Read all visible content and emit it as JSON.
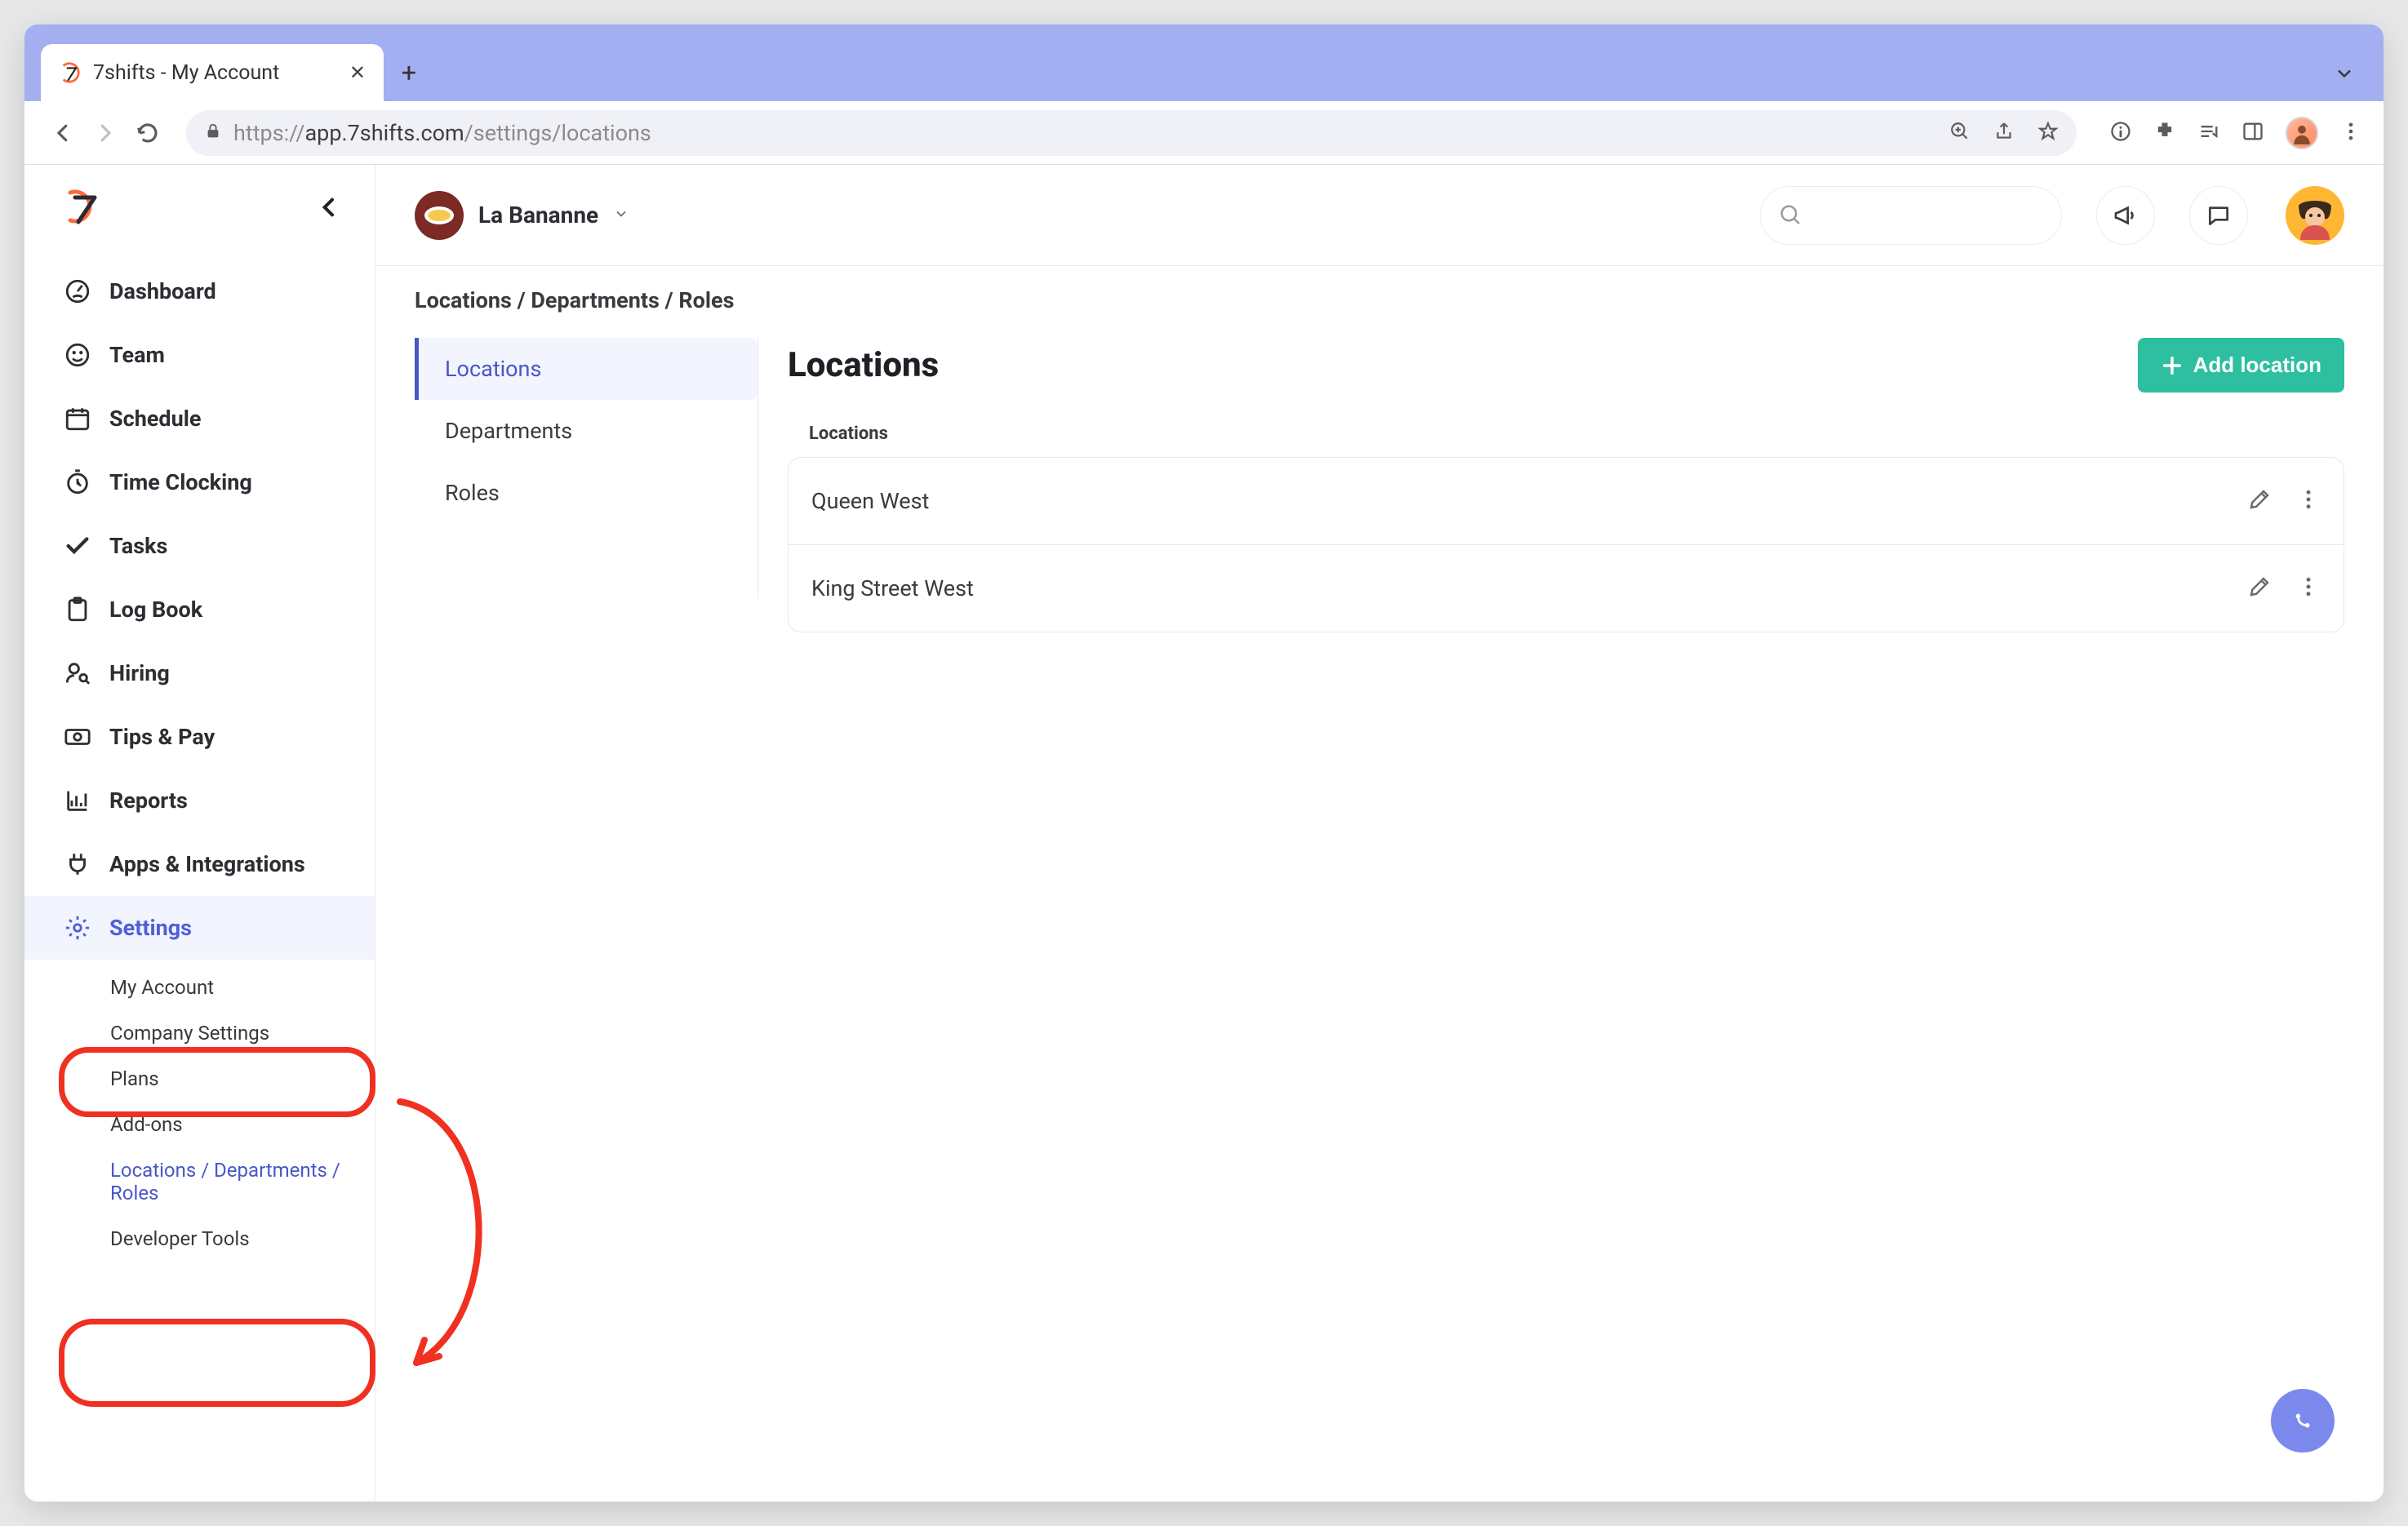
{
  "browser": {
    "tab_title": "7shifts - My Account",
    "url_host_prefix": "https://",
    "url_host_bold": "app.7shifts.com",
    "url_path": "/settings/locations"
  },
  "sidebar": {
    "items": [
      {
        "label": "Dashboard"
      },
      {
        "label": "Team"
      },
      {
        "label": "Schedule"
      },
      {
        "label": "Time Clocking"
      },
      {
        "label": "Tasks"
      },
      {
        "label": "Log Book"
      },
      {
        "label": "Hiring"
      },
      {
        "label": "Tips & Pay"
      },
      {
        "label": "Reports"
      },
      {
        "label": "Apps & Integrations"
      },
      {
        "label": "Settings"
      }
    ],
    "settings_sub": [
      {
        "label": "My Account"
      },
      {
        "label": "Company Settings"
      },
      {
        "label": "Plans"
      },
      {
        "label": "Add-ons"
      },
      {
        "label": "Locations / Departments / Roles"
      },
      {
        "label": "Developer Tools"
      }
    ]
  },
  "topbar": {
    "org_name": "La Bananne"
  },
  "content": {
    "breadcrumb": "Locations / Departments / Roles",
    "sub_tabs": [
      {
        "label": "Locations"
      },
      {
        "label": "Departments"
      },
      {
        "label": "Roles"
      }
    ],
    "panel_title": "Locations",
    "add_button": "Add location",
    "table_header": "Locations",
    "locations": [
      {
        "name": "Queen West"
      },
      {
        "name": "King Street West"
      }
    ]
  }
}
